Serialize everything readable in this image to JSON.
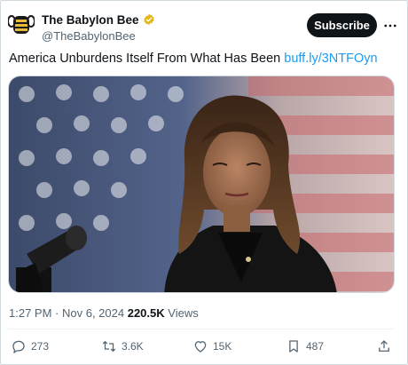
{
  "account": {
    "display_name": "The Babylon Bee",
    "handle": "@TheBabylonBee",
    "verified_color": "#e2b719"
  },
  "header": {
    "subscribe_label": "Subscribe",
    "more_icon": "more-horizontal-icon"
  },
  "tweet": {
    "text": "America Unburdens Itself From What Has Been",
    "link_text": "buff.ly/3NTFOyn",
    "link_color": "#1d9bf0"
  },
  "meta": {
    "time": "1:27 PM",
    "separator": " · ",
    "date": "Nov 6, 2024",
    "views_count": "220.5K",
    "views_label": "Views"
  },
  "actions": {
    "reply_count": "273",
    "retweet_count": "3.6K",
    "like_count": "15K",
    "bookmark_count": "487",
    "icons": [
      "reply-icon",
      "retweet-icon",
      "like-icon",
      "bookmark-icon",
      "share-icon"
    ]
  },
  "colors": {
    "text_primary": "#0f1419",
    "text_secondary": "#536471",
    "button_bg": "#0f1419"
  }
}
